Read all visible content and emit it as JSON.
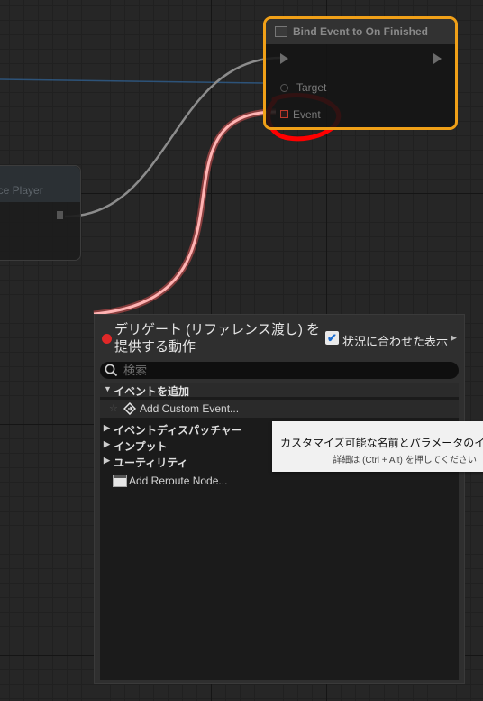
{
  "bind_node": {
    "title": "Bind Event to On Finished",
    "pins": {
      "target_label": "Target",
      "event_label": "Event"
    }
  },
  "left_node": {
    "title": "ace Player"
  },
  "menu": {
    "title": "デリゲート (リファレンス渡し) を提供する動作",
    "context_sensitive_label": "状況に合わせた表示",
    "context_sensitive_checked": true,
    "search_placeholder": "検索",
    "search_value": "",
    "categories": [
      {
        "label": "イベントを追加",
        "expanded": true
      },
      {
        "label": "イベントディスパッチャー",
        "expanded": false
      },
      {
        "label": "インプット",
        "expanded": false
      },
      {
        "label": "ユーティリティ",
        "expanded": false
      }
    ],
    "items": {
      "add_custom_event": "Add Custom Event...",
      "add_reroute_node": "Add Reroute Node..."
    }
  },
  "tooltip": {
    "main": "カスタマイズ可能な名前とパラメータのイベ",
    "sub": "詳細は (Ctrl + Alt) を押してください"
  },
  "colors": {
    "highlight_border": "#f0a018",
    "annotation_red": "#ff0000",
    "delegate_wire": "#ff8a8a",
    "exec_wire": "#8c8c8c",
    "checkbox_accent": "#1c6dd0"
  },
  "icons": [
    "search-icon",
    "chevron-down-icon",
    "chevron-right-icon",
    "event-diamond-icon",
    "reroute-node-icon",
    "star-icon",
    "checkmark-icon"
  ]
}
